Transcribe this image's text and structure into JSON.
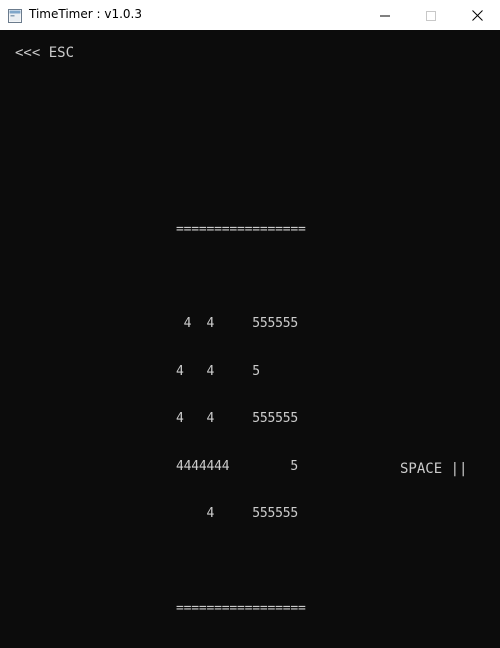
{
  "window": {
    "title": "TimeTimer : v1.0.3",
    "icon": "console-app-icon"
  },
  "console": {
    "esc_hint": "<<< ESC",
    "timer_lines": [
      "=================",
      "",
      " 4  4     555555",
      "4   4     5",
      "4   4     555555",
      "4444444        5",
      "    4     555555",
      "",
      "================="
    ],
    "space_hint": "SPACE ||"
  },
  "colors": {
    "background": "#0c0c0c",
    "text": "#cccccc",
    "titlebar": "#ffffff"
  }
}
